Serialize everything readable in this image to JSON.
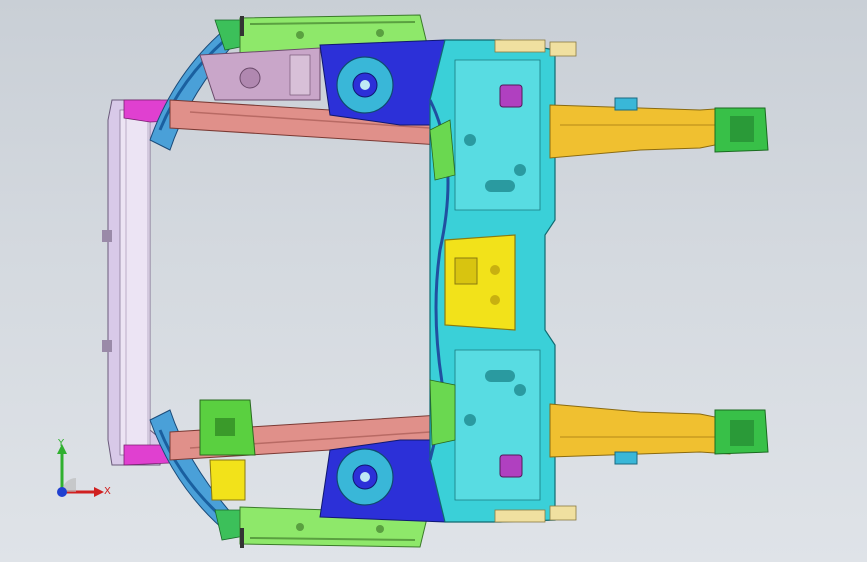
{
  "viewport": {
    "background_top": "#c9cfd6",
    "background_bottom": "#dfe3e8"
  },
  "model": {
    "description_colors": {
      "front_beam": "#d8c9e8",
      "front_beam_magenta": "#e040d0",
      "rail_salmon": "#e0908a",
      "bracket_green": "#7ee06a",
      "tower_blue": "#2c30d8",
      "tower_cyan": "#39b7d8",
      "cross_cyan": "#3ad0d8",
      "rear_yellow": "#f0c030",
      "insert_yellow": "#f2e21a",
      "mount_green": "#38c048",
      "mauve": "#c9a6c9"
    }
  },
  "triad": {
    "x_label": "X",
    "y_label": "Y",
    "x_color": "#d02020",
    "y_color": "#30b030",
    "z_color": "#2040d0"
  }
}
